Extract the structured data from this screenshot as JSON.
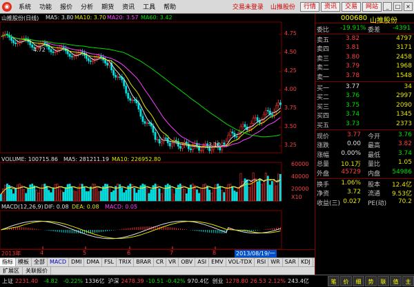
{
  "menubar": {
    "app_icon": "app-logo-icon",
    "menus": [
      "系统",
      "功能",
      "报价",
      "分析",
      "期货",
      "资讯",
      "工具",
      "帮助"
    ],
    "links": [
      "交易未登录",
      "山推股份"
    ],
    "buttons": [
      "行情",
      "资讯",
      "交易",
      "网站"
    ],
    "window_buttons": [
      "_",
      "□",
      "×"
    ]
  },
  "chart": {
    "title": "山推股份(日线)",
    "ma5_label": "MA5: 3.80",
    "ma10_label": "MA10: 3.70",
    "ma20_label": "MA20: 3.57",
    "ma60_label": "MA60: 3.42",
    "price_axis": [
      "4.75",
      "4.50",
      "4.25",
      "4.00",
      "3.75",
      "3.50",
      "3.25"
    ],
    "high_marker": "4.72",
    "low_marker": "3.10",
    "volume_title": "VOLUME: 100715.86",
    "vol_ma5": "MA5: 281211.19",
    "vol_ma10": "MA10: 226952.80",
    "volume_axis": [
      "60000",
      "40000",
      "20000"
    ],
    "volume_unit": "X10",
    "macd_title": "MACD(12,26,9)",
    "macd_dif": "DIF: 0.08",
    "macd_dea": "DEA: 0.08",
    "macd_val": "MACD: 0.05",
    "dates": [
      "2013年",
      "4",
      "5",
      "6",
      "7",
      "8"
    ],
    "date_cursor": "2013/08/19/一",
    "colors": {
      "ma5": "#e0e0e0",
      "ma10": "#e6e600",
      "ma20": "#ff40ff",
      "ma60": "#00e000",
      "up": "#ff3030",
      "down": "#00e0e0",
      "grid": "#800000"
    }
  },
  "ind_tabs": [
    "指标",
    "模板",
    "全部",
    "MACD",
    "DMI",
    "DMA",
    "FSL",
    "TRIX",
    "BRAR",
    "CR",
    "VR",
    "OBV",
    "ASI",
    "EMV",
    "VOL-TDX",
    "RSI",
    "WR",
    "SAR",
    "KDJ"
  ],
  "sub_tabs": [
    "扩展区",
    "关联报价"
  ],
  "quote": {
    "code": "000680",
    "name": "山推股份",
    "weibi_label": "委比",
    "weibi_value": "-19.91%",
    "weicha_label": "委差",
    "weicha_value": "-4391",
    "sells": [
      {
        "label": "卖五",
        "price": "3.82",
        "vol": "4797"
      },
      {
        "label": "卖四",
        "price": "3.81",
        "vol": "3171"
      },
      {
        "label": "卖三",
        "price": "3.80",
        "vol": "2458"
      },
      {
        "label": "卖二",
        "price": "3.79",
        "vol": "1968"
      },
      {
        "label": "卖一",
        "price": "3.78",
        "vol": "1548"
      }
    ],
    "buys": [
      {
        "label": "买一",
        "price": "3.77",
        "vol": "34"
      },
      {
        "label": "买二",
        "price": "3.76",
        "vol": "2997"
      },
      {
        "label": "买三",
        "price": "3.75",
        "vol": "2090"
      },
      {
        "label": "买四",
        "price": "3.74",
        "vol": "1345"
      },
      {
        "label": "买五",
        "price": "3.73",
        "vol": "2373"
      }
    ],
    "stats": [
      {
        "l1": "现价",
        "v1": "3.77",
        "l2": "今开",
        "v2": "3.76",
        "c1": "#ff4040",
        "c2": "#00e000"
      },
      {
        "l1": "涨跌",
        "v1": "0.00",
        "l2": "最高",
        "v2": "3.82",
        "c1": "#e0e0e0",
        "c2": "#ff4040"
      },
      {
        "l1": "涨幅",
        "v1": "0.00%",
        "l2": "最低",
        "v2": "3.74",
        "c1": "#e0e0e0",
        "c2": "#00e000"
      },
      {
        "l1": "总量",
        "v1": "10.1万",
        "l2": "量比",
        "v2": "1.05",
        "c1": "#e6e600",
        "c2": "#e6e600"
      },
      {
        "l1": "外盘",
        "v1": "45729",
        "l2": "内盘",
        "v2": "54986",
        "c1": "#ff4040",
        "c2": "#00e000"
      },
      {
        "l1": "换手",
        "v1": "1.06%",
        "l2": "股本",
        "v2": "12.4亿",
        "c1": "#e6e600",
        "c2": "#e6e600"
      },
      {
        "l1": "净资",
        "v1": "3.72",
        "l2": "流通",
        "v2": "9.53亿",
        "c1": "#e6e600",
        "c2": "#e6e600"
      },
      {
        "l1": "收益(三)",
        "v1": "0.027",
        "l2": "PE(动)",
        "v2": "70.2",
        "c1": "#e6e600",
        "c2": "#e6e600"
      }
    ]
  },
  "status": {
    "sh_label": "上证",
    "sh_index": "2231.40",
    "sh_change": "-4.82",
    "sh_pct": "-0.22%",
    "sh_amount": "1336亿",
    "sz_label": "沪深",
    "sz_index": "2478.39",
    "sz_change": "-10.51",
    "sz_pct": "-0.42%",
    "sz_amount": "970.4亿",
    "cy_label": "创业",
    "cy_index": "1278.80",
    "cy_change": "26.53",
    "cy_pct": "2.12%",
    "cy_amount": "243.4亿",
    "buttons": [
      "笔",
      "价",
      "细",
      "势",
      "联",
      "值",
      "主"
    ]
  }
}
